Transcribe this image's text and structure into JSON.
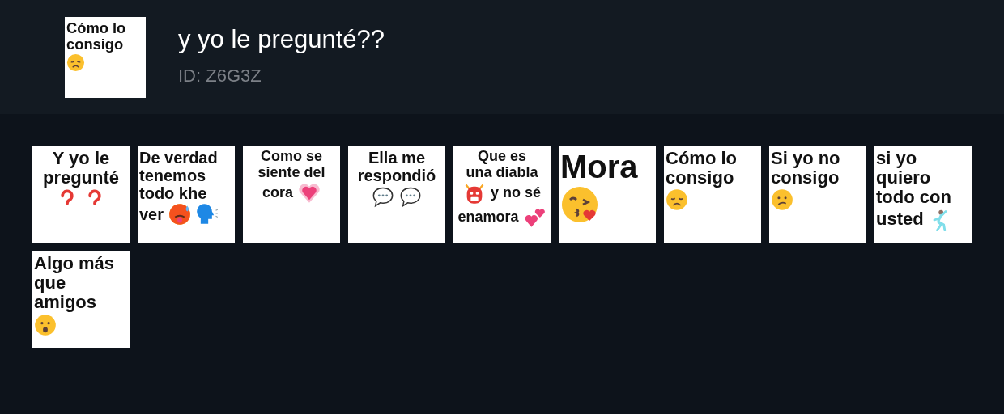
{
  "pack": {
    "title": "y yo le pregunté??",
    "id": "ID: Z6G3Z",
    "cover": {
      "centered": false,
      "lines": [
        [
          {
            "kind": "text",
            "text": "Cómo lo"
          }
        ],
        [
          {
            "kind": "text",
            "text": "consigo"
          }
        ],
        [
          {
            "kind": "sad"
          }
        ]
      ]
    }
  },
  "stickers": [
    {
      "centered": true,
      "lines": [
        [
          {
            "kind": "text",
            "text": "Y yo le"
          }
        ],
        [
          {
            "kind": "text",
            "text": "pregunté"
          }
        ],
        [
          {
            "kind": "question"
          },
          {
            "kind": "question"
          }
        ]
      ]
    },
    {
      "centered": false,
      "lines": [
        [
          {
            "kind": "text",
            "text": "De verdad"
          }
        ],
        [
          {
            "kind": "text",
            "text": "tenemos"
          }
        ],
        [
          {
            "kind": "text",
            "text": "todo khe"
          }
        ],
        [
          {
            "kind": "text",
            "text": "ver"
          },
          {
            "kind": "hot"
          },
          {
            "kind": "speaking"
          }
        ]
      ]
    },
    {
      "centered": true,
      "lines": [
        [
          {
            "kind": "text",
            "text": "Como se"
          }
        ],
        [
          {
            "kind": "text",
            "text": "siente del"
          }
        ],
        [
          {
            "kind": "text",
            "text": "cora"
          },
          {
            "kind": "heart"
          }
        ]
      ]
    },
    {
      "centered": true,
      "lines": [
        [
          {
            "kind": "text",
            "text": "Ella me"
          }
        ],
        [
          {
            "kind": "text",
            "text": "respondió"
          }
        ],
        [
          {
            "kind": "bubble"
          },
          {
            "kind": "bubble"
          }
        ]
      ]
    },
    {
      "centered": true,
      "lines": [
        [
          {
            "kind": "text",
            "text": "Que es"
          }
        ],
        [
          {
            "kind": "text",
            "text": "una diabla"
          }
        ],
        [
          {
            "kind": "ogre"
          },
          {
            "kind": "text",
            "text": "y no sé"
          }
        ],
        [
          {
            "kind": "text",
            "text": "enamora"
          },
          {
            "kind": "hearts"
          }
        ]
      ]
    },
    {
      "centered": false,
      "lines": [
        [
          {
            "kind": "text",
            "text": "Mora"
          }
        ],
        [
          {
            "kind": "kiss"
          }
        ]
      ]
    },
    {
      "centered": false,
      "lines": [
        [
          {
            "kind": "text",
            "text": "Cómo lo"
          }
        ],
        [
          {
            "kind": "text",
            "text": "consigo"
          }
        ],
        [
          {
            "kind": "sad"
          }
        ]
      ]
    },
    {
      "centered": false,
      "lines": [
        [
          {
            "kind": "text",
            "text": "Si yo no"
          }
        ],
        [
          {
            "kind": "text",
            "text": "consigo"
          }
        ],
        [
          {
            "kind": "confused"
          }
        ]
      ]
    },
    {
      "centered": false,
      "lines": [
        [
          {
            "kind": "text",
            "text": "si yo"
          }
        ],
        [
          {
            "kind": "text",
            "text": "quiero"
          }
        ],
        [
          {
            "kind": "text",
            "text": "todo con"
          }
        ],
        [
          {
            "kind": "text",
            "text": "usted"
          },
          {
            "kind": "dancer"
          }
        ]
      ]
    },
    {
      "centered": false,
      "lines": [
        [
          {
            "kind": "text",
            "text": "Algo más"
          }
        ],
        [
          {
            "kind": "text",
            "text": "que"
          }
        ],
        [
          {
            "kind": "text",
            "text": "amigos"
          }
        ],
        [
          {
            "kind": "surprised"
          }
        ]
      ]
    }
  ]
}
